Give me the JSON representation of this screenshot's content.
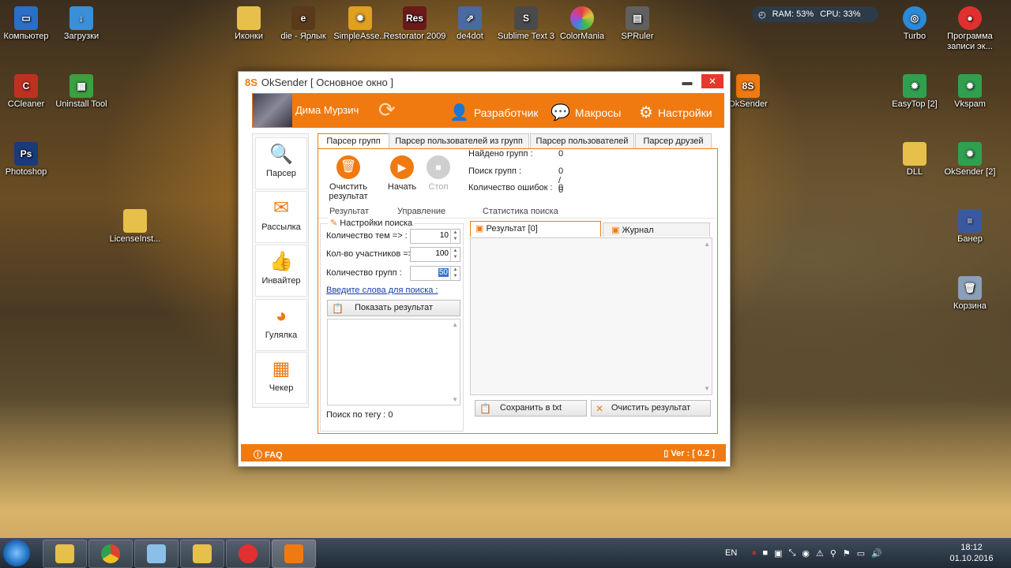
{
  "desktop": {
    "icons": [
      {
        "label": "Компьютер",
        "color": "#2a6fc9"
      },
      {
        "label": "Загрузки",
        "color": "#3a8fd8"
      },
      {
        "label": "Иконки",
        "color": "#e6c04a"
      },
      {
        "label": "die - Ярлык",
        "color": "#5a3a1a"
      },
      {
        "label": "SimpleAsse...",
        "color": "#e0a020"
      },
      {
        "label": "Restorator 2009",
        "color": "#6a1a1a"
      },
      {
        "label": "de4dot",
        "color": "#4a6aa0"
      },
      {
        "label": "Sublime Text 3",
        "color": "#4a4a4a"
      },
      {
        "label": "ColorMania",
        "color": "#e04040"
      },
      {
        "label": "SPRuler",
        "color": "#606060"
      },
      {
        "label": "Turbo",
        "color": "#2a8ad8"
      },
      {
        "label": "Программа записи эк...",
        "color": "#e03030"
      },
      {
        "label": "CCleaner",
        "color": "#c03020"
      },
      {
        "label": "Uninstall Tool",
        "color": "#3aa040"
      },
      {
        "label": "OkSender",
        "color": "#f07a10"
      },
      {
        "label": "EasyTop [2]",
        "color": "#30a050"
      },
      {
        "label": "Vkspam",
        "color": "#30a050"
      },
      {
        "label": "Photoshop",
        "color": "#1a3a7a"
      },
      {
        "label": "DLL",
        "color": "#e6c04a"
      },
      {
        "label": "OkSender [2]",
        "color": "#30a050"
      },
      {
        "label": "LicenseInst...",
        "color": "#e6c04a"
      },
      {
        "label": "Банер",
        "color": "#3a5aa0"
      },
      {
        "label": "Корзина",
        "color": "#8aa0b8"
      }
    ],
    "sysmon": {
      "ram": "RAM: 53%",
      "cpu": "CPU: 33%"
    }
  },
  "window": {
    "logo": "8S",
    "title": "OkSender [ Основное окно ]",
    "min_glyph": "▬",
    "close_glyph": "✕",
    "user_name": "Дима Мурзич",
    "header_buttons": [
      "Разработчик",
      "Макросы",
      "Настройки"
    ],
    "sidebar": [
      "Парсер",
      "Рассылка",
      "Инвайтер",
      "Гулялка",
      "Чекер"
    ],
    "tabs": [
      "Парсер групп",
      "Парсер пользователей из групп",
      "Парсер пользователей",
      "Парсер друзей"
    ],
    "ribbon": {
      "clear_label_1": "Очистить",
      "clear_label_2": "результат",
      "start_label": "Начать",
      "stop_label": "Стоп",
      "group_result": "Результат",
      "group_control": "Управление",
      "group_stats": "Статистика поиска"
    },
    "stats": [
      {
        "label": "Найдено групп :",
        "value": "0"
      },
      {
        "label": "Поиск групп :",
        "value": "0 / 0"
      },
      {
        "label": "Количество ошибок :",
        "value": "0"
      }
    ],
    "search": {
      "group_title": "Настройки поиска",
      "topics_label": "Количество тем =>  :",
      "topics_value": "10",
      "members_label": "Кол-во участников =>  :",
      "members_value": "100",
      "groups_label": "Количество групп  :",
      "groups_value": "50",
      "keywords_link": "Введите слова для поиска :",
      "show_result": "Показать результат",
      "tag_search": "Поиск по тегу :  0"
    },
    "results": {
      "tab_result": "Результат [0]",
      "tab_log": "Журнал",
      "save_txt": "Сохранить в txt",
      "clear_result": "Очистить результат"
    },
    "footer": {
      "faq": "FAQ",
      "version": "Ver : [ 0.2 ]"
    }
  },
  "taskbar": {
    "apps": [
      "folder",
      "chrome",
      "notepad",
      "explorer",
      "recorder",
      "oksender"
    ],
    "lang": "EN",
    "time": "18:12",
    "date": "01.10.2016"
  }
}
